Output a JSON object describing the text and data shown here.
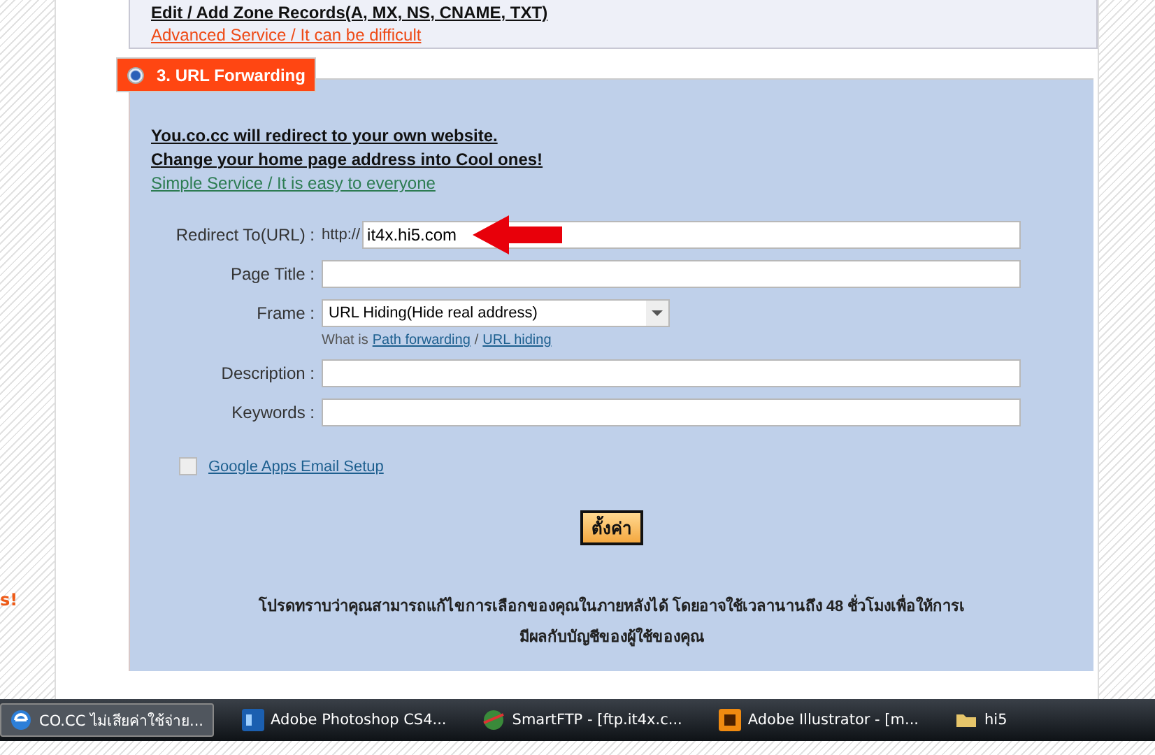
{
  "top_panel": {
    "title": "Edit / Add Zone Records(A, MX, NS, CNAME, TXT)",
    "subtitle": "Advanced Service / It can be difficult"
  },
  "left_fragment": "s!",
  "section": {
    "title": "3. URL Forwarding",
    "selected": true,
    "intro": [
      "You.co.cc will redirect to your own website.",
      "Change your home page address into Cool ones!"
    ],
    "subtitle": "Simple Service / It is easy to everyone"
  },
  "form": {
    "fields": [
      {
        "kind": "url",
        "label": "Redirect To(URL) :",
        "prefix": "http://",
        "value": "it4x.hi5.com"
      },
      {
        "kind": "text",
        "label": "Page Title :"
      },
      {
        "kind": "select",
        "label": "Frame :",
        "value": "URL Hiding(Hide real address)",
        "help": "What is",
        "links": [
          "Path forwarding",
          "URL hiding"
        ],
        "separator": "/"
      },
      {
        "kind": "text",
        "label": "Description :"
      },
      {
        "kind": "text",
        "label": "Keywords :"
      }
    ],
    "checkbox": {
      "label": "Google Apps Email Setup",
      "checked": false
    },
    "submit": "ตั้งค่า",
    "notice": [
      "โปรดทราบว่าคุณสามารถแก้ไขการเลือกของคุณในภายหลังได้ โดยอาจใช้เวลานานถึง 48 ชั่วโมงเพื่อให้การเ",
      "มีผลกับบัญชีของผู้ใช้ของคุณ"
    ]
  },
  "taskbar": [
    {
      "kind": "ie",
      "label": "CO.CC ไม่เสียค่าใช้จ่าย...",
      "selected": true
    },
    {
      "kind": "ps",
      "label": "Adobe Photoshop CS4...",
      "selected": false
    },
    {
      "kind": "ftp",
      "label": "SmartFTP - [ftp.it4x.c...",
      "selected": false
    },
    {
      "kind": "ai",
      "label": "Adobe Illustrator - [m...",
      "selected": false
    },
    {
      "kind": "folder",
      "label": "hi5",
      "selected": false
    }
  ]
}
